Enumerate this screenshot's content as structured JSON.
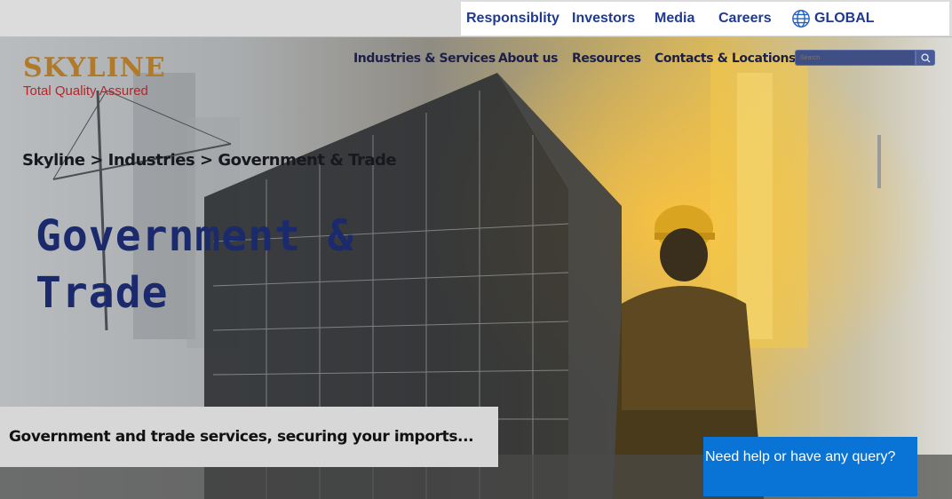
{
  "topbar": {
    "links": [
      "Responsiblity",
      "Investors",
      "Media",
      "Careers"
    ],
    "global_label": "GLOBAL",
    "link_color": "#1f3a8f"
  },
  "logo": {
    "name": "SKYLINE",
    "tagline": "Total Quality Assured",
    "name_color": "#b07a2a",
    "tagline_color": "#b3262b"
  },
  "nav": {
    "items": [
      "Industries & Services",
      "About us",
      "Resources",
      "Contacts & Locations"
    ],
    "search_placeholder": "Search",
    "search_icon": "magnifier-icon"
  },
  "breadcrumb": {
    "items": [
      "Skyline",
      "Industries",
      "Government & Trade"
    ],
    "separators": [
      ">",
      ">"
    ]
  },
  "hero": {
    "title_line1": "Government &",
    "title_line2": "Trade",
    "title_color": "#1a2a6c"
  },
  "tagline": {
    "text": "Government and trade services, securing your imports..."
  },
  "help": {
    "text": "Need help or have any query?",
    "background": "#0a73d6"
  }
}
